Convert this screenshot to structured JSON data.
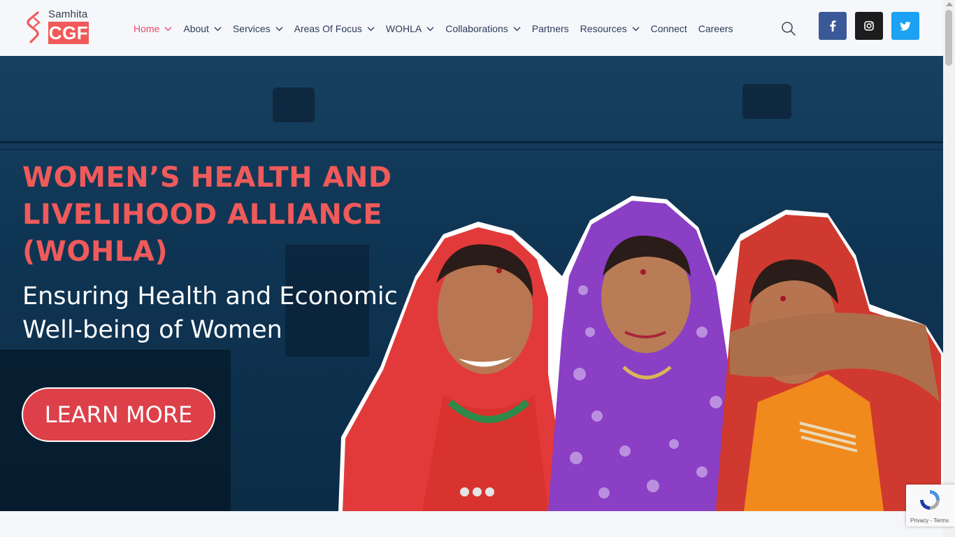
{
  "logo": {
    "top_text": "Samhita",
    "box_text": "CGF"
  },
  "nav": {
    "items": [
      {
        "label": "Home",
        "has_dropdown": true,
        "active": true
      },
      {
        "label": "About",
        "has_dropdown": true
      },
      {
        "label": "Services",
        "has_dropdown": true
      },
      {
        "label": "Areas Of Focus",
        "has_dropdown": true
      },
      {
        "label": "WOHLA",
        "has_dropdown": true
      },
      {
        "label": "Collaborations",
        "has_dropdown": true
      },
      {
        "label": "Partners",
        "has_dropdown": false
      },
      {
        "label": "Resources",
        "has_dropdown": true
      },
      {
        "label": "Connect",
        "has_dropdown": false
      },
      {
        "label": "Careers",
        "has_dropdown": false
      }
    ],
    "active_color": "#ec4a6b",
    "text_color": "#2d3b5c"
  },
  "header_icons": {
    "search": "search-icon",
    "social": [
      {
        "name": "facebook-icon",
        "color": "#3b5998",
        "glyph": "f"
      },
      {
        "name": "instagram-icon",
        "color": "#1d1d1d"
      },
      {
        "name": "twitter-icon",
        "color": "#1da1f2"
      }
    ]
  },
  "hero": {
    "title": "WOMEN’S HEALTH AND LIVELIHOOD ALLIANCE (WOHLA)",
    "subtitle": "Ensuring Health and Economic Well-being of Women",
    "button_label": "LEARN MORE",
    "title_color": "#ef5a5a",
    "button_color": "#dd4049",
    "slides": 3
  },
  "recaptcha": {
    "links": "Privacy - Terms"
  }
}
